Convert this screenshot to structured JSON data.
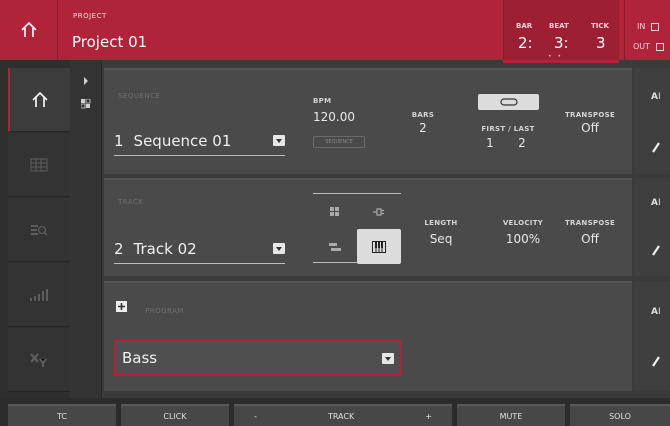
{
  "header": {
    "project_label": "PROJECT",
    "project_name": "Project 01",
    "bar_label": "BAR",
    "bar_value": "2:",
    "beat_label": "BEAT",
    "beat_value": "3:",
    "tick_label": "TICK",
    "tick_value": "3",
    "dots": "• •",
    "in_label": "IN",
    "out_label": "OUT",
    "accent_color": "#b0243a"
  },
  "sequence": {
    "title": "SEQUENCE",
    "number": "1",
    "name": "Sequence 01",
    "bpm_label": "BPM",
    "bpm_value": "120.00",
    "sequence_button": "SEQUENCE",
    "bars_label": "BARS",
    "bars_value": "2",
    "first_last_label": "FIRST / LAST",
    "first_value": "1",
    "last_value": "2",
    "transpose_label": "TRANSPOSE",
    "transpose_value": "Off"
  },
  "track": {
    "title": "TRACK",
    "number": "2",
    "name": "Track 02",
    "length_label": "LENGTH",
    "length_value": "Seq",
    "velocity_label": "VELOCITY",
    "velocity_value": "100%",
    "transpose_label": "TRANSPOSE",
    "transpose_value": "Off"
  },
  "program": {
    "title": "PROGRAM",
    "name": "Bass"
  },
  "footer": {
    "tc": "TC",
    "click": "CLICK",
    "minus": "-",
    "track": "TRACK",
    "plus": "+",
    "mute": "MUTE",
    "solo": "SOLO"
  }
}
